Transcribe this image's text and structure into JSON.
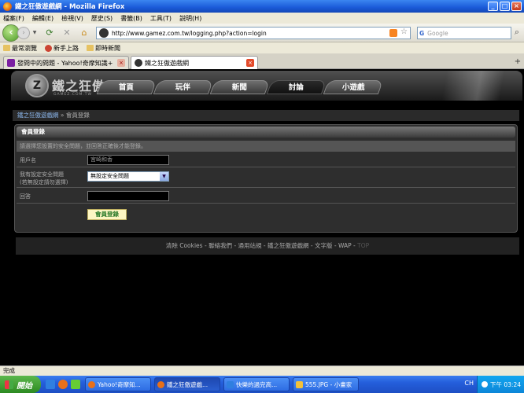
{
  "window": {
    "title": "鐵之狂傲遊戲網 - Mozilla Firefox",
    "minimize": "_",
    "maximize": "□",
    "close": "×"
  },
  "menu": [
    "檔案(F)",
    "編輯(E)",
    "檢視(V)",
    "歷史(S)",
    "書籤(B)",
    "工具(T)",
    "說明(H)"
  ],
  "nav": {
    "url": "http://www.gamez.com.tw/logging.php?action=login",
    "search_placeholder": "Google",
    "search_brand": "G"
  },
  "bookmarks": [
    "最常瀏覽",
    "新手上路",
    "即時新聞"
  ],
  "browser_tabs": [
    {
      "label": "發問中的問題 - Yahoo!奇摩知識+",
      "active": false
    },
    {
      "label": "鐵之狂傲遊戲網",
      "active": true
    }
  ],
  "site": {
    "logo_text": "鐵之狂傲",
    "logo_glyph": "Z",
    "logo_sub": "GAMEZ.COM.TW",
    "nav_tabs": [
      "首頁",
      "玩伴",
      "新聞",
      "討論",
      "小遊戲"
    ],
    "active_tab": "討論",
    "breadcrumb": {
      "home": "鐵之狂傲遊戲網",
      "separator": " » ",
      "current": "會員登錄"
    }
  },
  "panel": {
    "title": "會員登錄",
    "hint": "請選擇您設置的安全問題，並回答正確後才能登錄。",
    "username_label": "用戶名",
    "username_value": "宮崎和香",
    "question_label": "我有設定安全問題",
    "question_sublabel": "(若無設定請勿選擇)",
    "question_value": "無設定安全問題",
    "answer_label": "回答",
    "answer_value": "",
    "submit_label": "會員登錄"
  },
  "footer": {
    "links": [
      "清除 Cookies",
      "聯絡我們",
      "通用站規",
      "鐵之狂傲遊戲網",
      "文字版",
      "WAP"
    ],
    "top": "TOP",
    "separator": " - "
  },
  "status": "完成",
  "taskbar": {
    "start": "開始",
    "tasks": [
      "Yahoo!奇摩知...",
      "鐵之狂傲遊戲...",
      "快樂的過完高...",
      "555.JPG - 小畫家"
    ],
    "ime": "CH",
    "clock": "下午 03:24"
  }
}
